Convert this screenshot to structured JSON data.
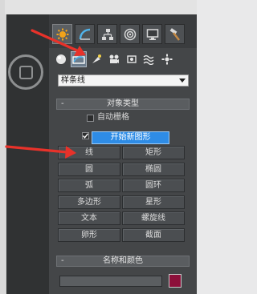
{
  "panel": {
    "dropdown": {
      "selected": "样条线"
    },
    "object_type": {
      "title": "对象类型",
      "collapse_symbol": "-",
      "autogrid_label": "自动栅格",
      "start_new_shape_label": "开始新图形",
      "buttons": [
        "线",
        "矩形",
        "圆",
        "椭圆",
        "弧",
        "圆环",
        "多边形",
        "星形",
        "文本",
        "螺旋线",
        "卵形",
        "截面"
      ]
    },
    "name_color": {
      "title": "名称和颜色",
      "collapse_symbol": "-",
      "color": "#8c0f3a"
    },
    "tabs": [
      "create-icon",
      "modify-icon",
      "hierarchy-icon",
      "motion-icon",
      "display-icon",
      "utilities-icon"
    ],
    "subtypes": [
      "geometry-icon",
      "shapes-icon",
      "lights-icon",
      "cameras-icon",
      "helpers-icon",
      "spacewarps-icon",
      "systems-icon"
    ]
  },
  "annotation_color": "#e8322a",
  "accent": "#2e8ce6"
}
